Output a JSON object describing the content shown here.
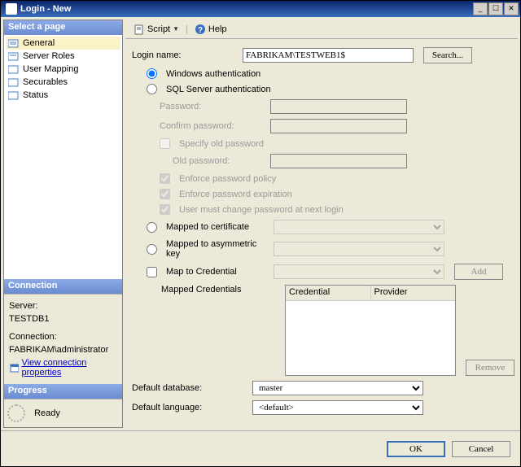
{
  "window": {
    "title": "Login - New"
  },
  "pages": {
    "header": "Select a page",
    "items": [
      {
        "label": "General",
        "selected": true
      },
      {
        "label": "Server Roles"
      },
      {
        "label": "User Mapping"
      },
      {
        "label": "Securables"
      },
      {
        "label": "Status"
      }
    ]
  },
  "connection": {
    "header": "Connection",
    "server_label": "Server:",
    "server_value": "TESTDB1",
    "conn_label": "Connection:",
    "conn_value": "FABRIKAM\\administrator",
    "link": "View connection properties"
  },
  "progress": {
    "header": "Progress",
    "status": "Ready"
  },
  "toolbar": {
    "script": "Script",
    "help": "Help"
  },
  "form": {
    "login_name_label": "Login name:",
    "login_name_value": "FABRIKAM\\TESTWEB1$",
    "search_btn": "Search...",
    "auth_windows": "Windows authentication",
    "auth_sql": "SQL Server authentication",
    "password_label": "Password:",
    "confirm_label": "Confirm password:",
    "specify_old": "Specify old password",
    "old_password_label": "Old password:",
    "enforce_policy": "Enforce password policy",
    "enforce_expire": "Enforce password expiration",
    "must_change": "User must change password at next login",
    "mapped_cert": "Mapped to certificate",
    "mapped_asym": "Mapped to asymmetric key",
    "map_cred": "Map to Credential",
    "add_btn": "Add",
    "mapped_creds_label": "Mapped Credentials",
    "col_credential": "Credential",
    "col_provider": "Provider",
    "remove_btn": "Remove",
    "default_db_label": "Default database:",
    "default_db_value": "master",
    "default_lang_label": "Default language:",
    "default_lang_value": "<default>"
  },
  "buttons": {
    "ok": "OK",
    "cancel": "Cancel"
  }
}
